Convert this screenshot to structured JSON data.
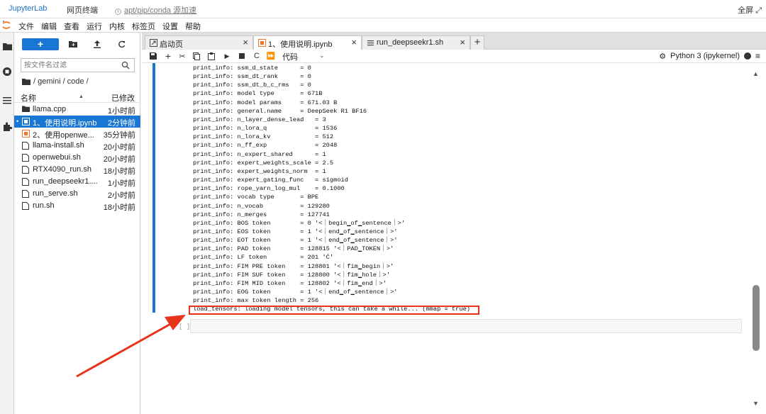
{
  "topbar": {
    "brand": "JupyterLab",
    "terminal": "网页终端",
    "mirror": "apt/pip/conda 源加速",
    "fullscreen": "全屏"
  },
  "menu": [
    "文件",
    "编辑",
    "查看",
    "运行",
    "内核",
    "标签页",
    "设置",
    "帮助"
  ],
  "filebrowser": {
    "new_label": "+",
    "filter_placeholder": "按文件名过滤",
    "path": "/ gemini / code /",
    "col_name": "名称",
    "col_modified": "已修改",
    "files": [
      {
        "name": "llama.cpp",
        "time": "1小时前",
        "icon": "folder-icon"
      },
      {
        "name": "1、使用说明.ipynb",
        "time": "2分钟前",
        "icon": "notebook-icon",
        "selected": true
      },
      {
        "name": "2、使用openwe...",
        "time": "35分钟前",
        "icon": "notebook-icon"
      },
      {
        "name": "llama-install.sh",
        "time": "20小时前",
        "icon": "file-icon"
      },
      {
        "name": "openwebui.sh",
        "time": "20小时前",
        "icon": "file-icon"
      },
      {
        "name": "RTX4090_run.sh",
        "time": "18小时前",
        "icon": "file-icon"
      },
      {
        "name": "run_deepseekr1....",
        "time": "1小时前",
        "icon": "file-icon"
      },
      {
        "name": "run_serve.sh",
        "time": "2小时前",
        "icon": "file-icon"
      },
      {
        "name": "run.sh",
        "time": "18小时前",
        "icon": "file-icon"
      }
    ]
  },
  "tabs": [
    {
      "label": "启动页"
    },
    {
      "label": "1、使用说明.ipynb"
    },
    {
      "label": "run_deepseekr1.sh"
    }
  ],
  "toolbar": {
    "cell_type": "代码",
    "kernel": "Python 3 (ipykernel)"
  },
  "output_lines": [
    "print_info: ssm_d_state      = 0",
    "print_info: ssm_dt_rank      = 0",
    "print_info: ssm_dt_b_c_rms   = 0",
    "print_info: model type       = 671B",
    "print_info: model params     = 671.03 B",
    "print_info: general.name     = DeepSeek R1 BF16",
    "print_info: n_layer_dense_lead   = 3",
    "print_info: n_lora_q             = 1536",
    "print_info: n_lora_kv            = 512",
    "print_info: n_ff_exp             = 2048",
    "print_info: n_expert_shared      = 1",
    "print_info: expert_weights_scale = 2.5",
    "print_info: expert_weights_norm  = 1",
    "print_info: expert_gating_func   = sigmoid",
    "print_info: rope_yarn_log_mul    = 0.1000",
    "print_info: vocab type       = BPE",
    "print_info: n_vocab          = 129280",
    "print_info: n_merges         = 127741",
    "print_info: BOS token        = 0 '<｜begin▁of▁sentence｜>'",
    "print_info: EOS token        = 1 '<｜end▁of▁sentence｜>'",
    "print_info: EOT token        = 1 '<｜end▁of▁sentence｜>'",
    "print_info: PAD token        = 128815 '<｜PAD▁TOKEN｜>'",
    "print_info: LF token         = 201 'Ċ'",
    "print_info: FIM PRE token    = 128801 '<｜fim▁begin｜>'",
    "print_info: FIM SUF token    = 128800 '<｜fim▁hole｜>'",
    "print_info: FIM MID token    = 128802 '<｜fim▁end｜>'",
    "print_info: EOG token        = 1 '<｜end▁of▁sentence｜>'",
    "print_info: max token length = 256",
    "load_tensors: loading model tensors, this can take a while... (mmap = true)"
  ],
  "prompt": "[ ]:",
  "colors": {
    "accent": "#1976d2",
    "highlight": "#e8331c"
  }
}
